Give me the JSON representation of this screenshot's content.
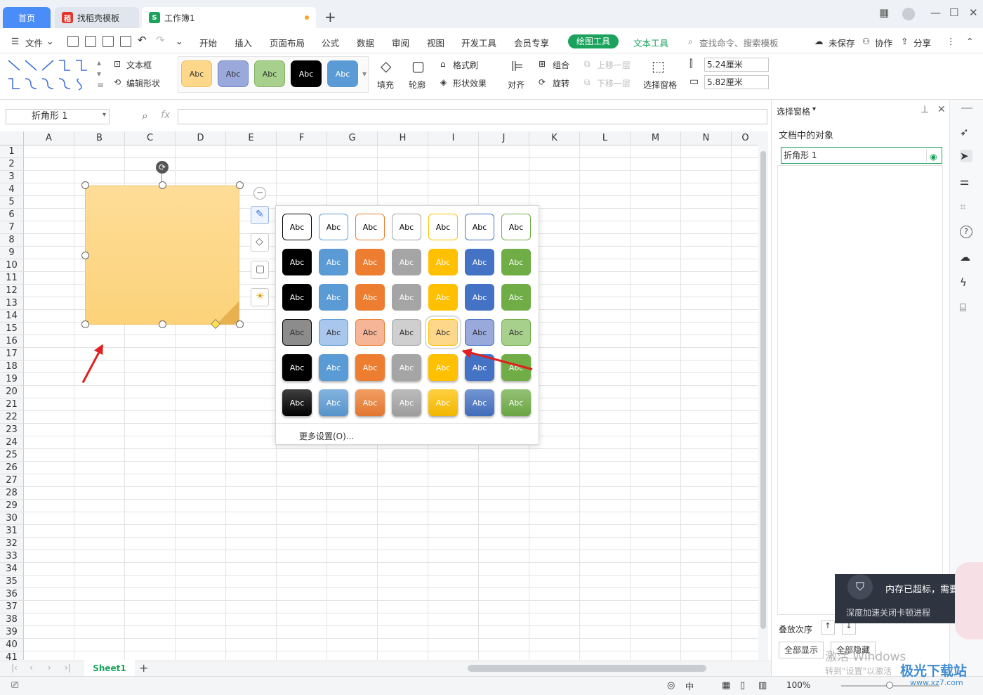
{
  "tabs": {
    "home": "首页",
    "template": "找稻壳模板",
    "workbook": "工作簿1"
  },
  "menu": {
    "file": "文件",
    "items": [
      "开始",
      "插入",
      "页面布局",
      "公式",
      "数据",
      "审阅",
      "视图",
      "开发工具",
      "会员专享"
    ],
    "draw_tool": "绘图工具",
    "text_tool": "文本工具",
    "search": "查找命令、搜索模板",
    "unsaved": "未保存",
    "collab": "协作",
    "share": "分享"
  },
  "ribbon": {
    "textbox": "文本框",
    "edit_shape": "编辑形状",
    "style_label": "Abc",
    "fill": "填充",
    "outline": "轮廓",
    "format_painter": "格式刷",
    "shape_effect": "形状效果",
    "align": "对齐",
    "group": "组合",
    "rotate": "旋转",
    "bring_forward": "上移一层",
    "send_backward": "下移一层",
    "selection_pane": "选择窗格",
    "height": "5.24厘米",
    "width": "5.82厘米"
  },
  "namebox": "折角形  1",
  "fx": "fx",
  "columns": [
    "A",
    "B",
    "C",
    "D",
    "E",
    "F",
    "G",
    "H",
    "I",
    "J",
    "K",
    "L",
    "M",
    "N",
    "O"
  ],
  "rows": [
    "1",
    "2",
    "3",
    "4",
    "5",
    "6",
    "7",
    "8",
    "9",
    "10",
    "11",
    "12",
    "13",
    "14",
    "15",
    "16",
    "17",
    "18",
    "19",
    "20",
    "21",
    "22",
    "23",
    "24",
    "25",
    "26",
    "27",
    "28",
    "29",
    "30",
    "31",
    "32",
    "33",
    "34",
    "35",
    "36",
    "37",
    "38",
    "39",
    "40",
    "41"
  ],
  "gallery": {
    "label": "Abc",
    "more": "更多设置(O)..."
  },
  "pane": {
    "title": "选择窗格",
    "section": "文档中的对象",
    "object": "折角形 1",
    "order": "叠放次序",
    "show_all": "全部显示",
    "hide_all": "全部隐藏"
  },
  "toast": {
    "title": "内存已超标，需要",
    "sub": "深度加速关闭卡顿进程"
  },
  "sheet": {
    "name": "Sheet1"
  },
  "status": {
    "zoom": "100%",
    "lang": "中"
  },
  "watermark": {
    "activate": "激活 Windows",
    "hint": "转到\"设置\"以激活",
    "site": "极光下载站",
    "url": "www.xz7.com"
  },
  "colors": {
    "accent": "#1ba35d",
    "home_tab": "#4b8df8",
    "shape_fill": "#fdd88a",
    "arrow": "#e02020"
  }
}
